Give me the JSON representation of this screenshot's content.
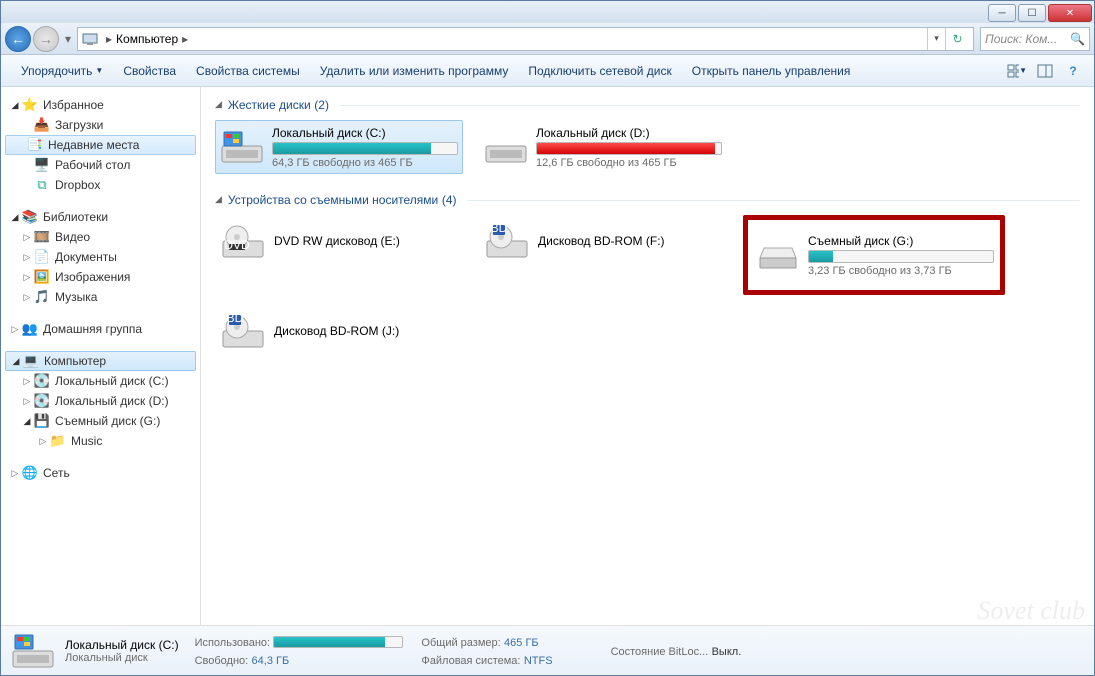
{
  "breadcrumb": {
    "root": "Компьютер"
  },
  "search": {
    "placeholder": "Поиск: Ком..."
  },
  "toolbar": {
    "organize": "Упорядочить",
    "properties": "Свойства",
    "sys_props": "Свойства системы",
    "uninstall": "Удалить или изменить программу",
    "map_drive": "Подключить сетевой диск",
    "control_panel": "Открыть панель управления"
  },
  "sidebar": {
    "favorites": "Избранное",
    "downloads": "Загрузки",
    "recent": "Недавние места",
    "desktop": "Рабочий стол",
    "dropbox": "Dropbox",
    "libraries": "Библиотеки",
    "videos": "Видео",
    "documents": "Документы",
    "pictures": "Изображения",
    "music_lib": "Музыка",
    "homegroup": "Домашняя группа",
    "computer": "Компьютер",
    "drive_c": "Локальный диск (C:)",
    "drive_d": "Локальный диск (D:)",
    "drive_g": "Съемный диск (G:)",
    "music_fold": "Music",
    "network": "Сеть"
  },
  "groups": {
    "hdd": {
      "title": "Жесткие диски",
      "count": "(2)"
    },
    "removable": {
      "title": "Устройства со съемными носителями",
      "count": "(4)"
    }
  },
  "drives": {
    "c": {
      "name": "Локальный диск (C:)",
      "sub": "64,3 ГБ свободно из 465 ГБ",
      "pct": 86
    },
    "d": {
      "name": "Локальный диск (D:)",
      "sub": "12,6 ГБ свободно из 465 ГБ",
      "pct": 97
    },
    "e": {
      "name": "DVD RW дисковод (E:)"
    },
    "f": {
      "name": "Дисковод BD-ROM (F:)"
    },
    "g": {
      "name": "Съемный диск (G:)",
      "sub": "3,23 ГБ свободно из 3,73 ГБ",
      "pct": 13
    },
    "j": {
      "name": "Дисковод BD-ROM (J:)"
    }
  },
  "details": {
    "title": "Локальный диск (C:)",
    "type": "Локальный диск",
    "used_lbl": "Использовано:",
    "free_lbl": "Свободно:",
    "free_val": "64,3 ГБ",
    "total_lbl": "Общий размер:",
    "total_val": "465 ГБ",
    "fs_lbl": "Файловая система:",
    "fs_val": "NTFS",
    "bl_lbl": "Состояние BitLoc...",
    "bl_val": "Выкл.",
    "bar_pct": 86
  },
  "watermark": "Sovet club"
}
